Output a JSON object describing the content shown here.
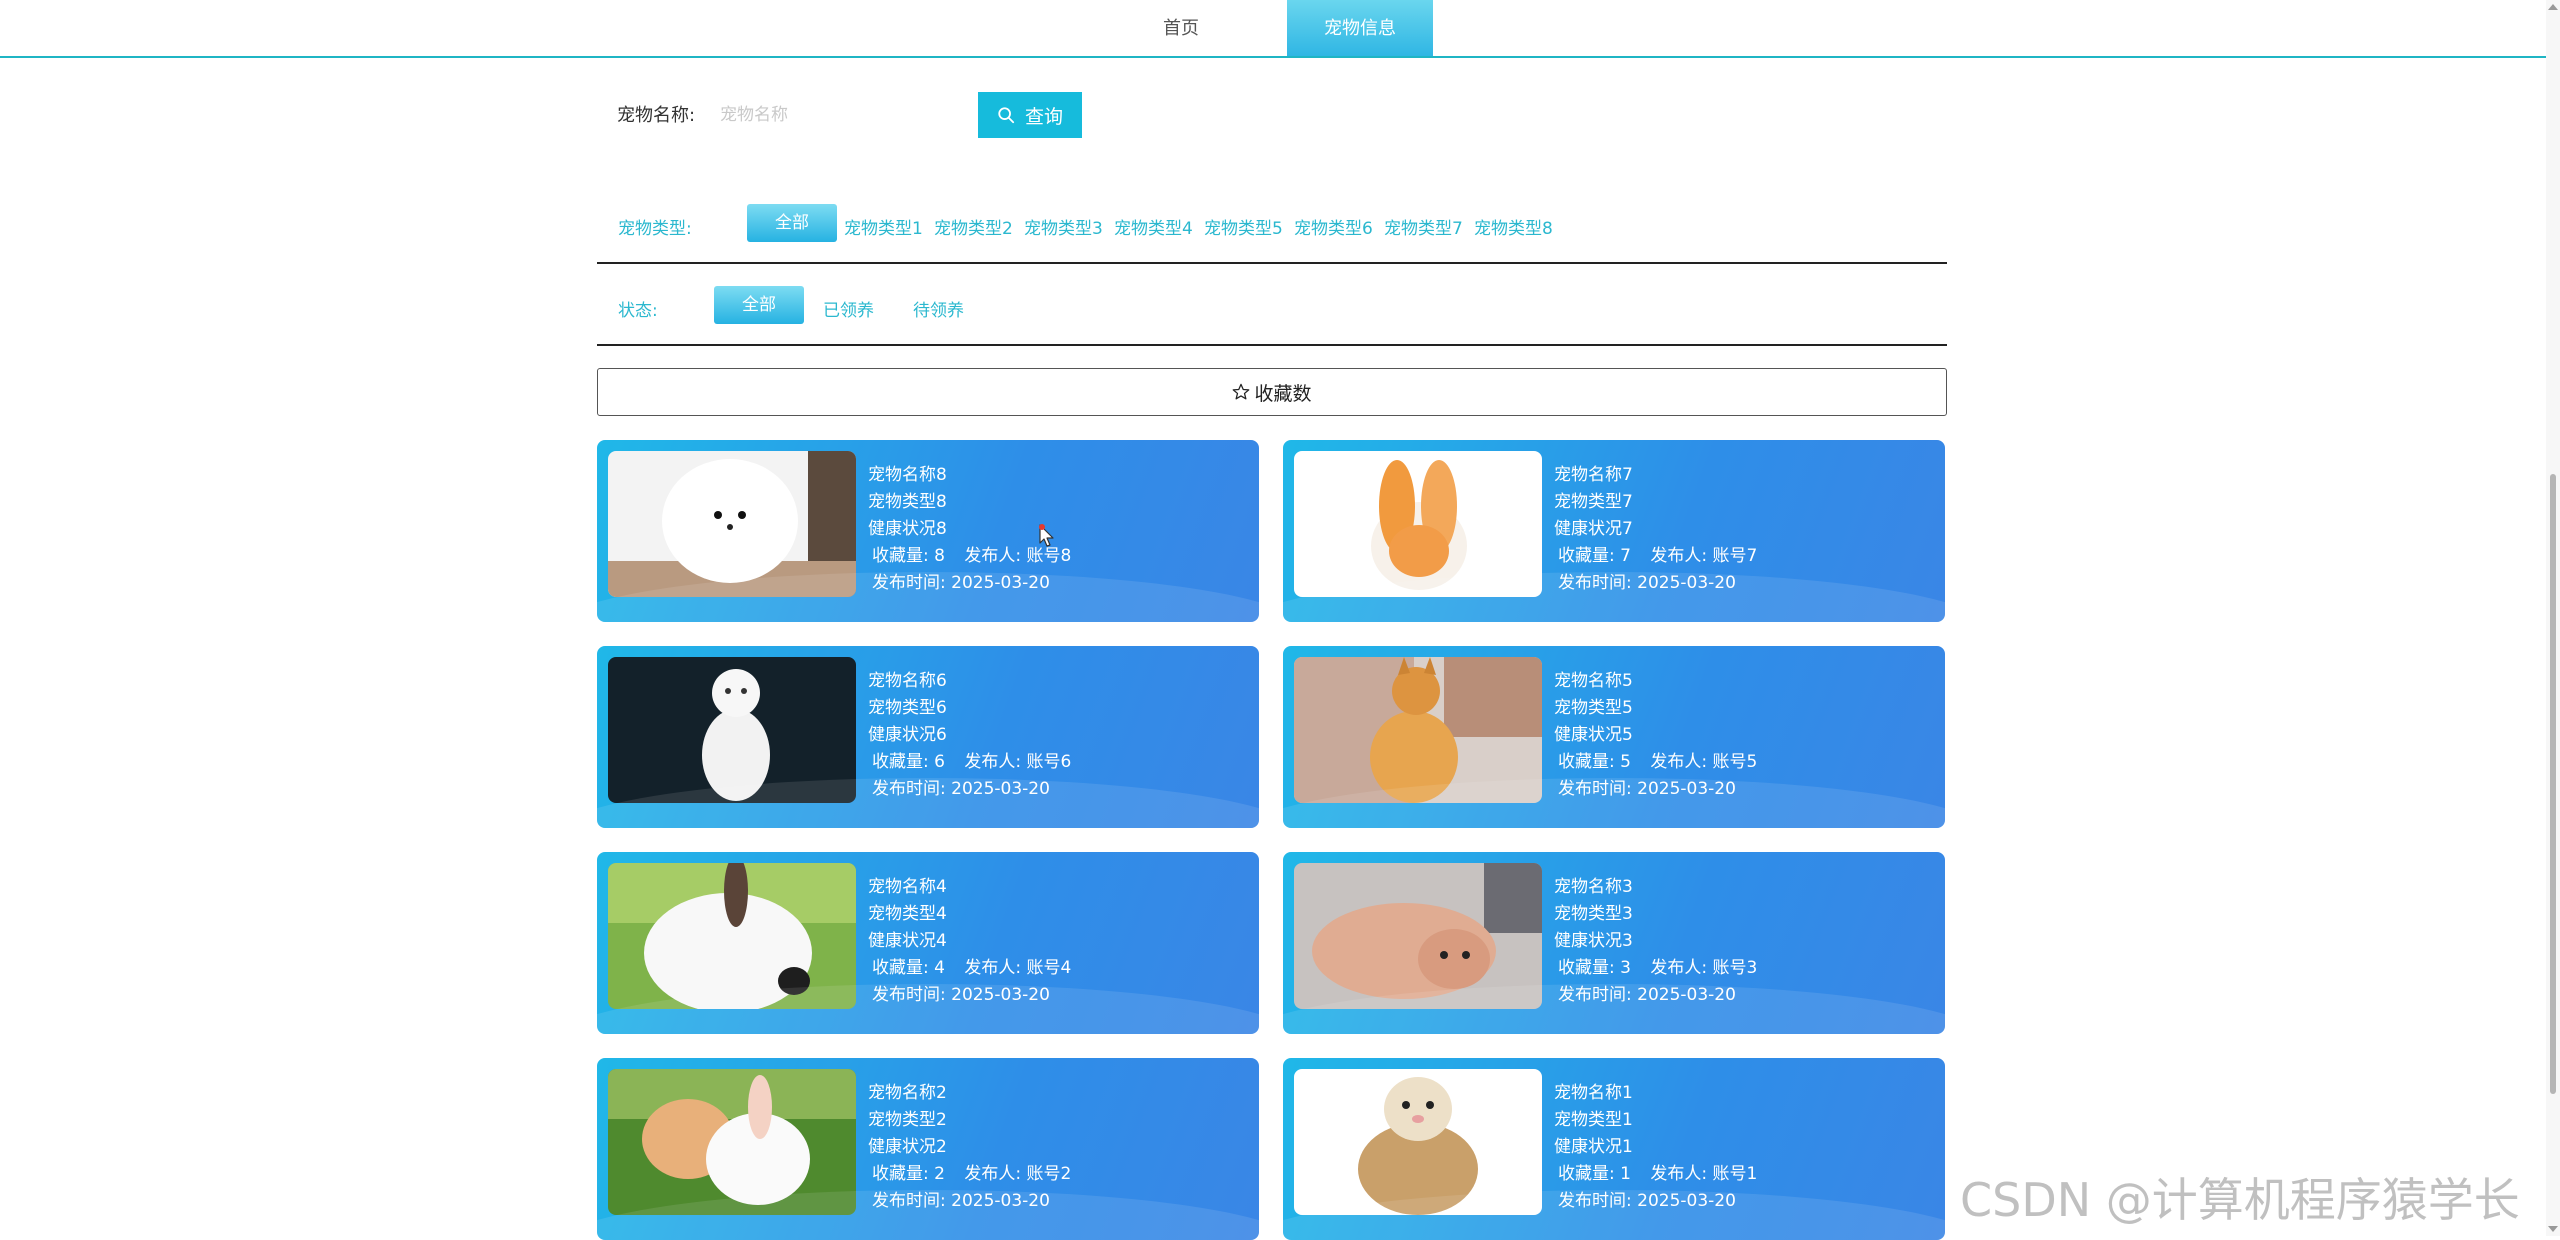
{
  "nav": {
    "tabs": [
      {
        "label": "首页"
      },
      {
        "label": "宠物信息"
      }
    ]
  },
  "search": {
    "label": "宠物名称:",
    "placeholder": "宠物名称",
    "button_label": "查询"
  },
  "filters": {
    "type": {
      "label": "宠物类型:",
      "options": [
        "全部",
        "宠物类型1",
        "宠物类型2",
        "宠物类型3",
        "宠物类型4",
        "宠物类型5",
        "宠物类型6",
        "宠物类型7",
        "宠物类型8"
      ]
    },
    "status": {
      "label": "状态:",
      "options": [
        "全部",
        "已领养",
        "待领养"
      ]
    }
  },
  "sort": {
    "label": "收藏数"
  },
  "meta_labels": {
    "favorites": "收藏量:",
    "publisher": "发布人:",
    "time": "发布时间:"
  },
  "pets": [
    {
      "name": "宠物名称8",
      "type": "宠物类型8",
      "health": "健康状况8",
      "favorites": "8",
      "publisher": "账号8",
      "time": "2025-03-20"
    },
    {
      "name": "宠物名称7",
      "type": "宠物类型7",
      "health": "健康状况7",
      "favorites": "7",
      "publisher": "账号7",
      "time": "2025-03-20"
    },
    {
      "name": "宠物名称6",
      "type": "宠物类型6",
      "health": "健康状况6",
      "favorites": "6",
      "publisher": "账号6",
      "time": "2025-03-20"
    },
    {
      "name": "宠物名称5",
      "type": "宠物类型5",
      "health": "健康状况5",
      "favorites": "5",
      "publisher": "账号5",
      "time": "2025-03-20"
    },
    {
      "name": "宠物名称4",
      "type": "宠物类型4",
      "health": "健康状况4",
      "favorites": "4",
      "publisher": "账号4",
      "time": "2025-03-20"
    },
    {
      "name": "宠物名称3",
      "type": "宠物类型3",
      "health": "健康状况3",
      "favorites": "3",
      "publisher": "账号3",
      "time": "2025-03-20"
    },
    {
      "name": "宠物名称2",
      "type": "宠物类型2",
      "health": "健康状况2",
      "favorites": "2",
      "publisher": "账号2",
      "time": "2025-03-20"
    },
    {
      "name": "宠物名称1",
      "type": "宠物类型1",
      "health": "健康状况1",
      "favorites": "1",
      "publisher": "账号1",
      "time": "2025-03-20"
    }
  ],
  "watermark": "CSDN @计算机程序猿学长",
  "colors": {
    "accent": "#16bbdc",
    "card_start": "#20b8e8",
    "card_end": "#3a86e6",
    "filter_text": "#2bb8cf"
  }
}
